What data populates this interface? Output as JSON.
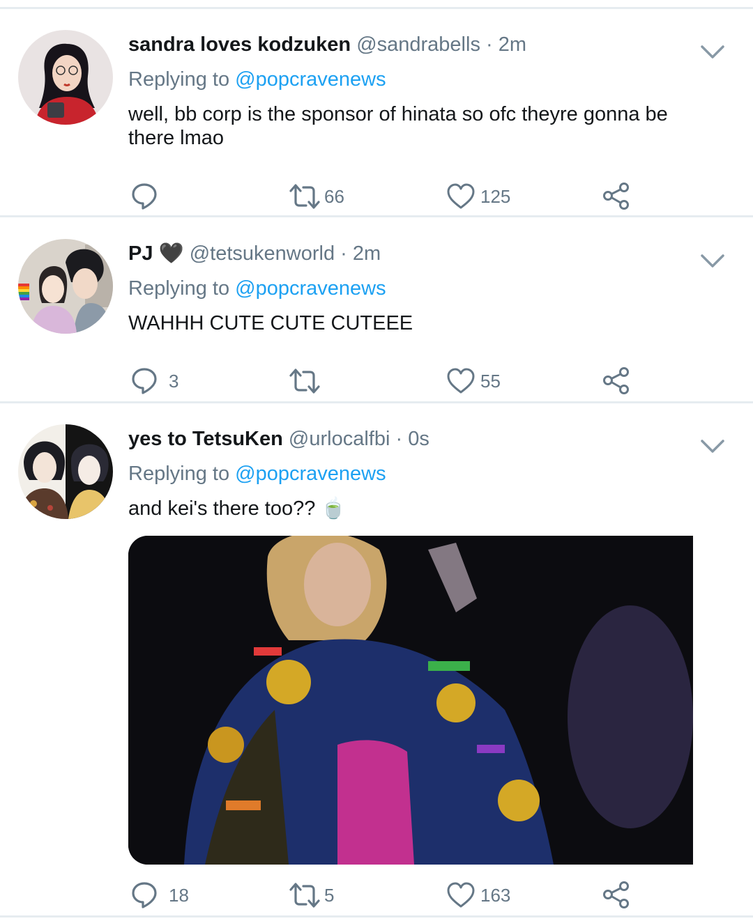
{
  "tweets": [
    {
      "display_name": "sandra loves kodzuken",
      "handle": "@sandrabells",
      "separator": "·",
      "time": "2m",
      "replying_prefix": "Replying to",
      "replying_to": "@popcravenews",
      "text": "well, bb corp is the sponsor of hinata so ofc theyre gonna be there lmao",
      "replies": "",
      "retweets": "66",
      "likes": "125"
    },
    {
      "display_name": "PJ",
      "name_emoji": "🖤",
      "handle": "@tetsukenworld",
      "separator": "·",
      "time": "2m",
      "replying_prefix": "Replying to",
      "replying_to": "@popcravenews",
      "text": "WAHHH CUTE CUTE CUTEEE",
      "replies": "3",
      "retweets": "",
      "likes": "55"
    },
    {
      "display_name": "yes to TetsuKen",
      "handle": "@urlocalfbi",
      "separator": "·",
      "time": "0s",
      "replying_prefix": "Replying to",
      "replying_to": "@popcravenews",
      "text": "and kei's there too?? 🍵",
      "has_media": true,
      "replies": "18",
      "retweets": "5",
      "likes": "163"
    }
  ],
  "icons": {
    "reply": "reply-icon",
    "retweet": "retweet-icon",
    "like": "heart-icon",
    "share": "share-icon",
    "more": "chevron-down-icon"
  },
  "colors": {
    "text": "#14171a",
    "secondary": "#657786",
    "link": "#1da1f2",
    "divider": "#e6ecf0"
  }
}
